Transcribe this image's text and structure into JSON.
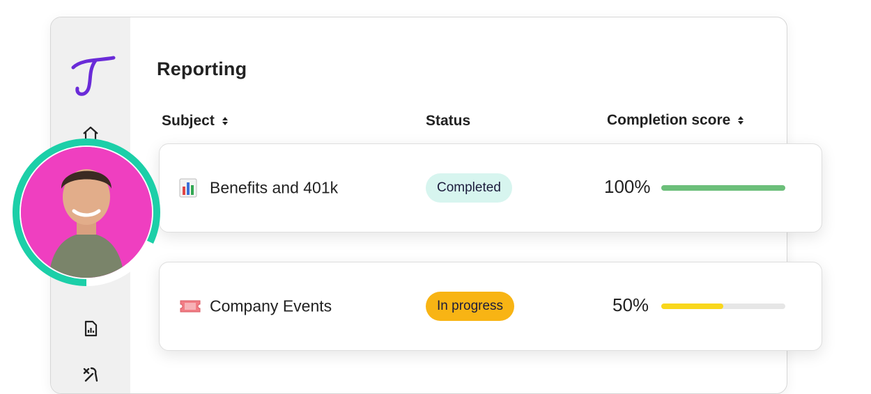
{
  "page": {
    "title": "Reporting"
  },
  "table": {
    "headers": {
      "subject": "Subject",
      "status": "Status",
      "score": "Completion score"
    },
    "rows": [
      {
        "emoji": "📊",
        "subject": "Benefits and 401k",
        "status": "Completed",
        "status_color": "#d7f5ef",
        "score_text": "100%",
        "progress": 1.0,
        "bar_color": "#6cbf7a"
      },
      {
        "emoji": "🎟️",
        "subject": "Company Events",
        "status": "In progress",
        "status_color": "#f8b414",
        "score_text": "50%",
        "progress": 0.5,
        "bar_color": "#f9d71c"
      }
    ]
  },
  "colors": {
    "brand": "#6a2bd8",
    "avatar_ring": "#1ccfa8",
    "avatar_bg": "#ef3fc0"
  },
  "icons": [
    "logo-icon",
    "home-icon",
    "report-icon",
    "tools-icon",
    "sort-icon"
  ]
}
